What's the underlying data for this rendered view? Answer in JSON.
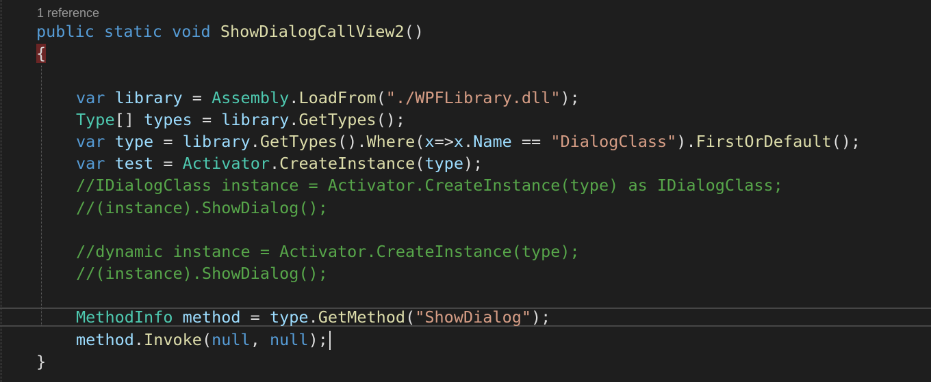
{
  "codelens": {
    "text": "1 reference"
  },
  "code": {
    "l1": {
      "kw1": "public",
      "kw2": "static",
      "kw3": "void",
      "method": "ShowDialogCallView2",
      "punct": "()"
    },
    "l2": {
      "brace": "{"
    },
    "l4": {
      "kw": "var",
      "v": "library",
      "eq": " = ",
      "type": "Assembly",
      "dot": ".",
      "fn": "LoadFrom",
      "p1": "(",
      "str": "\"./WPFLibrary.dll\"",
      "p2": ");"
    },
    "l5": {
      "type": "Type",
      "br": "[] ",
      "v": "types",
      "eq": " = ",
      "v2": "library",
      "dot": ".",
      "fn": "GetTypes",
      "p": "();"
    },
    "l6": {
      "kw": "var",
      "v": "type",
      "eq": " = ",
      "v2": "library",
      "dot1": ".",
      "fn1": "GetTypes",
      "p1": "().",
      "fn2": "Where",
      "p2": "(",
      "v3": "x",
      "arrow": "=>",
      "v4": "x",
      "dot2": ".",
      "v5": "Name",
      "eqeq": " == ",
      "str": "\"DialogClass\"",
      "p3": ").",
      "fn3": "FirstOrDefault",
      "p4": "();"
    },
    "l7": {
      "kw": "var",
      "v": "test",
      "eq": " = ",
      "type": "Activator",
      "dot": ".",
      "fn": "CreateInstance",
      "p1": "(",
      "v2": "type",
      "p2": ");"
    },
    "l8": {
      "comment": "//IDialogClass instance = Activator.CreateInstance(type) as IDialogClass;"
    },
    "l9": {
      "comment": "//(instance).ShowDialog();"
    },
    "l11": {
      "comment": "//dynamic instance = Activator.CreateInstance(type);"
    },
    "l12": {
      "comment": "//(instance).ShowDialog();"
    },
    "l14": {
      "type": "MethodInfo",
      "v": "method",
      "eq": " = ",
      "v2": "type",
      "dot": ".",
      "fn": "GetMethod",
      "p1": "(",
      "str": "\"ShowDialog\"",
      "p2": ");"
    },
    "l15": {
      "v": "method",
      "dot": ".",
      "fn": "Invoke",
      "p1": "(",
      "kw1": "null",
      "comma": ", ",
      "kw2": "null",
      "p2": ");"
    },
    "l16": {
      "brace": "}"
    }
  },
  "colors": {
    "background": "#1e1e1e",
    "keyword": "#569cd6",
    "type": "#4ec9b0",
    "method": "#dcdcaa",
    "variable": "#9cdcfe",
    "string": "#d69d85",
    "comment": "#57a64a",
    "brace_highlight": "#6b2525"
  }
}
